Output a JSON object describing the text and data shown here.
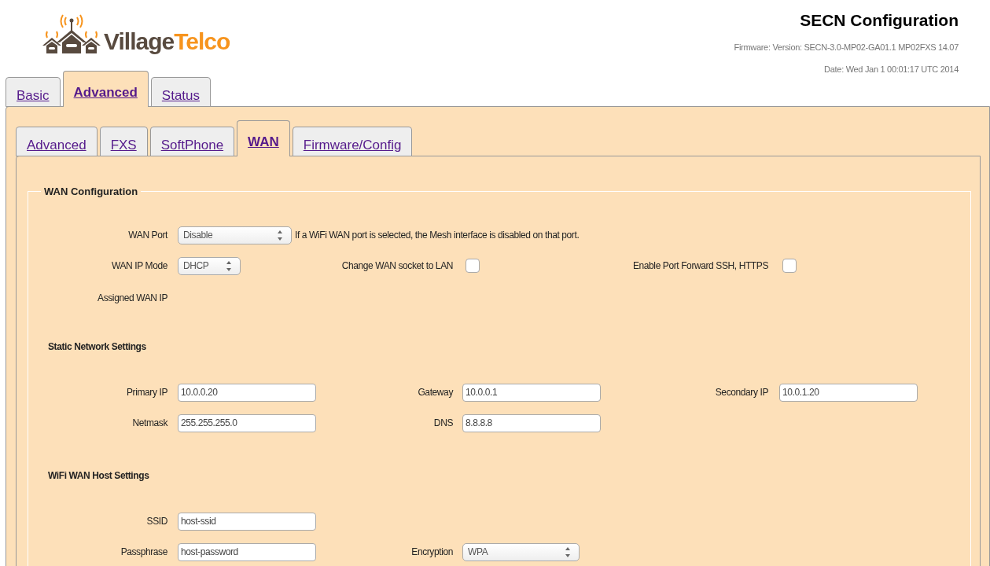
{
  "header": {
    "logo": {
      "first": "Village",
      "second": "Telco"
    },
    "title": "SECN Configuration",
    "firmware": "Firmware: Version: SECN-3.0-MP02-GA01.1 MP02FXS 14.07",
    "date": "Date: Wed Jan 1 00:01:17 UTC 2014"
  },
  "top_tabs": [
    {
      "label": "Basic",
      "selected": false
    },
    {
      "label": "Advanced",
      "selected": true
    },
    {
      "label": "Status",
      "selected": false
    }
  ],
  "sub_tabs": [
    {
      "label": "Advanced",
      "selected": false
    },
    {
      "label": "FXS",
      "selected": false
    },
    {
      "label": "SoftPhone",
      "selected": false
    },
    {
      "label": "WAN",
      "selected": true
    },
    {
      "label": "Firmware/Config",
      "selected": false
    }
  ],
  "wan_configuration": {
    "legend": "WAN Configuration",
    "wan_port": {
      "label": "WAN Port",
      "value": "Disable",
      "hint": "If a WiFi WAN port is selected, the Mesh interface is disabled on that port."
    },
    "wan_ip_mode": {
      "label": "WAN IP Mode",
      "value": "DHCP"
    },
    "change_wan_socket": {
      "label": "Change WAN socket to LAN",
      "checked": false
    },
    "port_forward": {
      "label": "Enable Port Forward SSH, HTTPS",
      "checked": false
    },
    "assigned_wan_ip": {
      "label": "Assigned WAN IP"
    }
  },
  "static_network_settings": {
    "heading": "Static Network Settings",
    "rows": [
      [
        {
          "label": "Primary IP",
          "value": "10.0.0.20",
          "kind": "text"
        },
        {
          "label": "Gateway",
          "value": "10.0.0.1",
          "kind": "text"
        },
        {
          "label": "Secondary IP",
          "value": "10.0.1.20",
          "kind": "text"
        }
      ],
      [
        {
          "label": "Netmask",
          "value": "255.255.255.0",
          "kind": "text"
        },
        {
          "label": "DNS",
          "value": "8.8.8.8",
          "kind": "text"
        }
      ]
    ]
  },
  "wifi_wan_host_settings": {
    "heading": "WiFi WAN Host Settings",
    "rows": [
      [
        {
          "label": "SSID",
          "value": "host-ssid",
          "kind": "text"
        }
      ],
      [
        {
          "label": "Passphrase",
          "value": "host-password",
          "kind": "text"
        },
        {
          "label": "Encryption",
          "value": "WPA",
          "kind": "select"
        }
      ]
    ]
  }
}
